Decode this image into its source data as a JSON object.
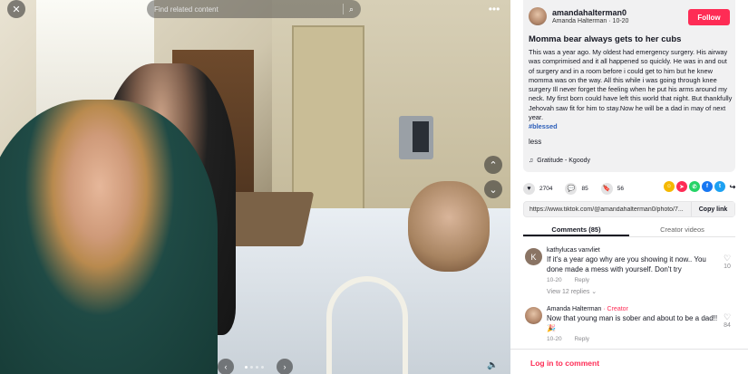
{
  "photo": {
    "search_placeholder": "Find related content",
    "close_glyph": "✕",
    "more_glyph": "•••",
    "search_glyph": "⌕",
    "up_glyph": "⌃",
    "down_glyph": "⌄",
    "prev_glyph": "‹",
    "next_glyph": "›",
    "volume_glyph": "🔈"
  },
  "post": {
    "username": "amandahalterman0",
    "display_name": "Amanda Halterman",
    "date": "10-20",
    "follow_label": "Follow",
    "title": "Momma bear always gets to her cubs",
    "description": "This was a year ago. My oldest had emergency surgery. His airway was comprimised and it all happened so quickly. He was in and out of surgery and in a room before i could get to him but he knew momma was on the way. All this while i was going through knee surgery Ill never forget the feeling when he put his arms around my neck. My first born could have left this world that night. But thankfully Jehovah saw fit for him to stay.Now he will be a dad in may of next year.",
    "hashtag": "#blessed",
    "less_label": "less",
    "music": "Gratitude - Kgoody"
  },
  "actions": {
    "likes": "2704",
    "comments": "85",
    "saves": "56"
  },
  "link": {
    "url": "https://www.tiktok.com/@amandahalterman0/photo/7...",
    "copy_label": "Copy link"
  },
  "tabs": {
    "comments": "Comments (85)",
    "creator_videos": "Creator videos"
  },
  "comments": [
    {
      "avatar_letter": "K",
      "name": "kathylucas vanvliet",
      "creator_tag": "",
      "text": "If it's a year ago why are you showing it now.. You done made a mess with yourself. Don't try",
      "date": "10-20",
      "reply_label": "Reply",
      "view_replies": "View 12 replies ⌄",
      "likes": "10"
    },
    {
      "avatar_letter": "",
      "name": "Amanda Halterman",
      "creator_tag": " · Creator",
      "text": "Now that young man is sober and about to be a dad!! 🎉",
      "date": "10-20",
      "reply_label": "Reply",
      "likes": "84"
    }
  ],
  "footer": {
    "login_label": "Log in to comment"
  },
  "colors": {
    "accent": "#fe2c55",
    "hashtag": "#2b5db9"
  }
}
